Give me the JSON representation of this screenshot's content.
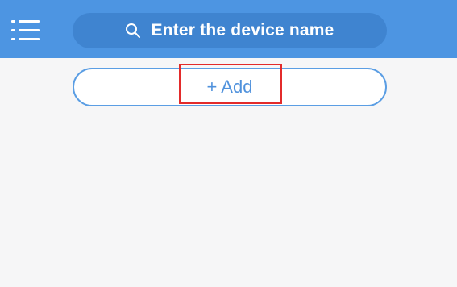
{
  "header": {
    "background_color": "#4d95e2",
    "menu_icon": "menu-icon",
    "search": {
      "icon": "search-icon",
      "placeholder": "Enter the device name"
    }
  },
  "main": {
    "add_button_label": "+ Add"
  },
  "annotation": {
    "highlight_color": "#e32b2b",
    "target": "add-button"
  }
}
